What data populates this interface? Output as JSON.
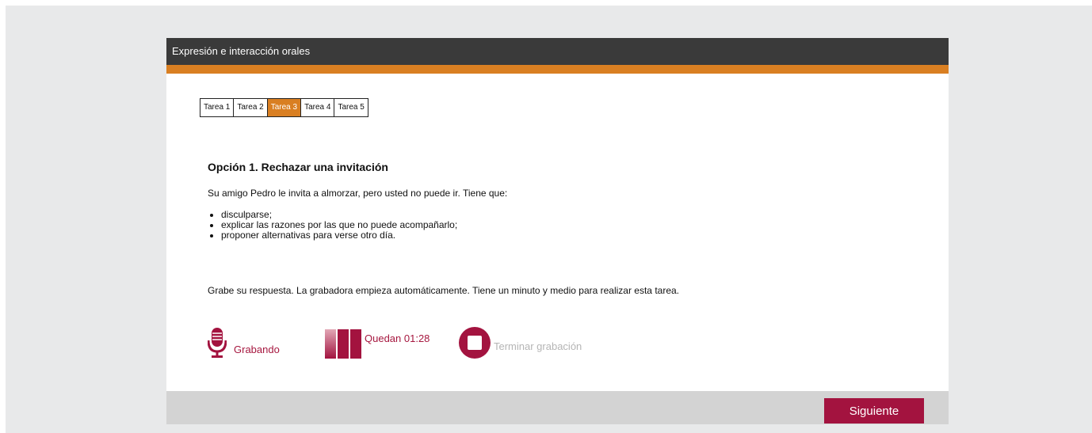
{
  "header": {
    "title": "Expresión e interacción orales"
  },
  "tabs": [
    {
      "label": "Tarea 1",
      "active": false
    },
    {
      "label": "Tarea 2",
      "active": false
    },
    {
      "label": "Tarea 3",
      "active": true
    },
    {
      "label": "Tarea 4",
      "active": false
    },
    {
      "label": "Tarea 5",
      "active": false
    }
  ],
  "task": {
    "title": "Opción 1. Rechazar una invitación",
    "intro": "Su amigo Pedro le invita a almorzar, pero usted no puede ir. Tiene que:",
    "bullets": [
      "disculparse;",
      "explicar las razones por las que no puede acompañarlo;",
      "proponer alternativas para verse otro día."
    ],
    "instruction": "Grabe su respuesta. La grabadora empieza automáticamente. Tiene un minuto y medio para realizar esta tarea."
  },
  "recorder": {
    "status_label": "Grabando",
    "status_icon": "microphone-icon",
    "timer_label": "Quedan 01:28",
    "timer_icon": "time-bars-icon",
    "stop_label": "Terminar grabación",
    "stop_icon": "stop-icon"
  },
  "footer": {
    "next_label": "Siguiente"
  },
  "colors": {
    "accent_orange": "#d97f22",
    "brand_red": "#a3133f",
    "header_dark": "#3a3a3a",
    "disabled_gray": "#b5b5b5"
  }
}
